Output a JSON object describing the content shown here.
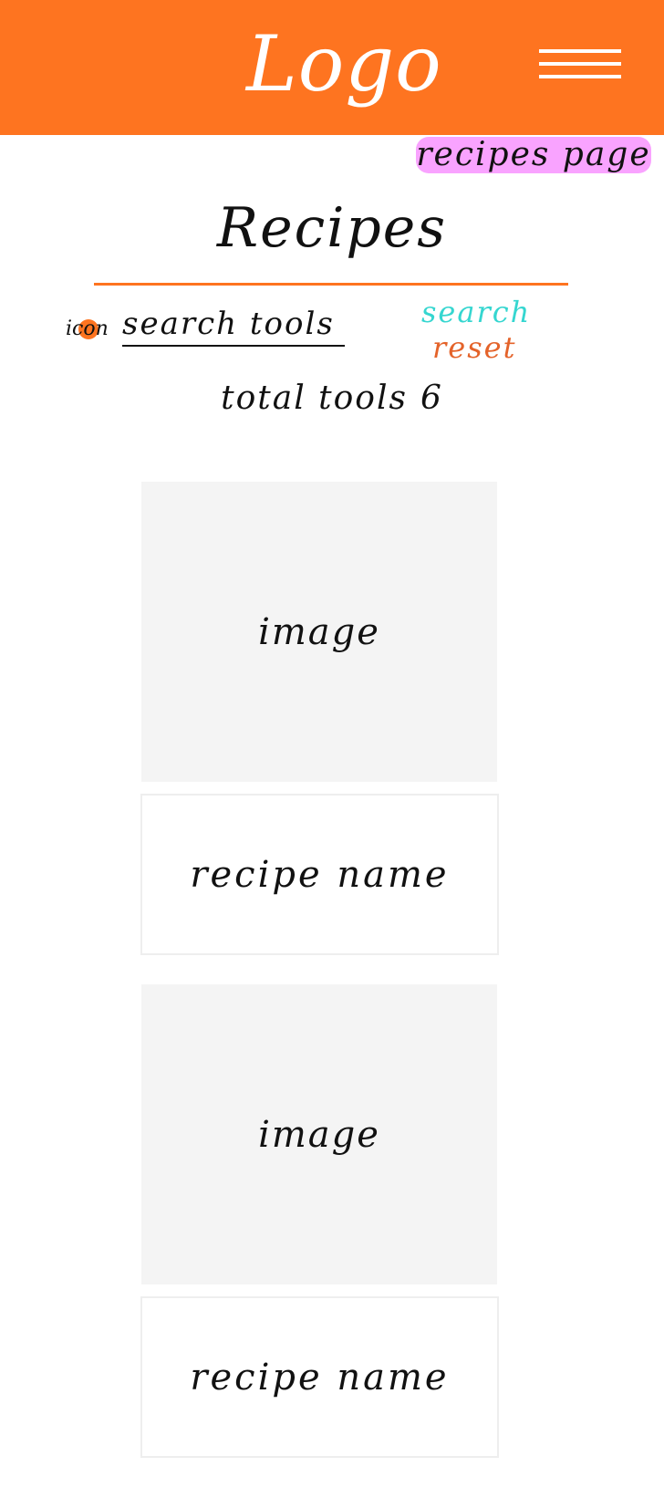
{
  "header": {
    "logo_text": "Logo",
    "menu_icon": "hamburger-menu-icon",
    "background_color": "#fe7420"
  },
  "page_tag": {
    "label": "recipes page",
    "highlight_color": "#f9a3ff"
  },
  "main": {
    "title": "Recipes",
    "accent_color": "#fe7420"
  },
  "search": {
    "icon_label": "icon",
    "icon_color": "#fe7420",
    "placeholder": "search tools",
    "search_label": "search",
    "search_color": "#35d6d0",
    "reset_label": "reset",
    "reset_color": "#e4632a"
  },
  "totals": {
    "label": "total tools",
    "count": "6"
  },
  "recipes": [
    {
      "image_label": "image",
      "name": "recipe name"
    },
    {
      "image_label": "image",
      "name": "recipe name"
    }
  ]
}
